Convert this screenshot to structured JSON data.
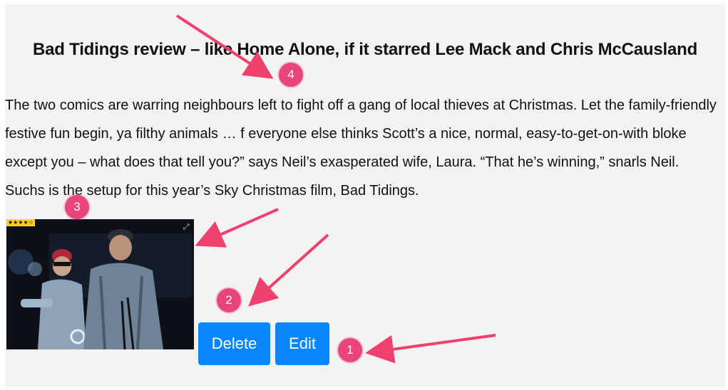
{
  "article": {
    "title": "Bad Tidings review – like Home Alone, if it starred Lee Mack and Chris McCausland",
    "body": "The two comics are warring neighbours left to fight off a gang of local thieves at Christmas. Let the family-friendly festive fun begin, ya filthy animals … f everyone else thinks Scott’s a nice, normal, easy-to-get-on-with bloke except you – what does that tell you?” says Neil’s exasperated wife, Laura. “That he’s winning,” snarls Neil. Suchs is the setup for this year’s Sky Christmas film, Bad Tidings.",
    "image": {
      "rating_stars": "★★★★☆",
      "expand_icon": "expand-icon"
    }
  },
  "actions": {
    "delete_label": "Delete",
    "edit_label": "Edit"
  },
  "annotations": {
    "markers": [
      "1",
      "2",
      "3",
      "4"
    ],
    "color": "#e8457a"
  },
  "colors": {
    "button": "#0a84ff",
    "page_background": "#f3f3f3"
  }
}
